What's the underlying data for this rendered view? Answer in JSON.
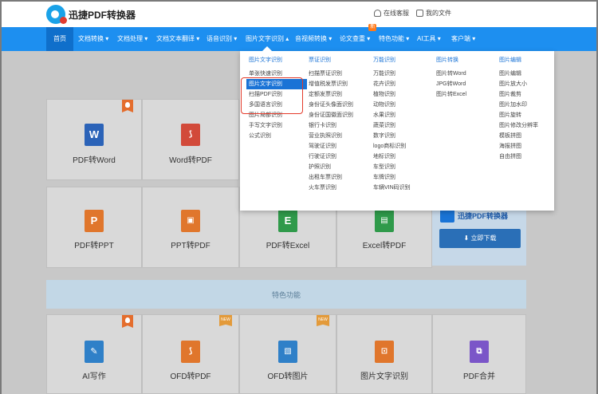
{
  "header": {
    "brand": "迅捷PDF转换器",
    "service_label": "在线客服",
    "files_label": "我的文件"
  },
  "nav": {
    "items": [
      {
        "label": "首页"
      },
      {
        "label": "文档转换 ▾"
      },
      {
        "label": "文档处理 ▾"
      },
      {
        "label": "文档文本翻译 ▾"
      },
      {
        "label": "语音识别 ▾"
      },
      {
        "label": "图片文字识别 ▴"
      },
      {
        "label": "音视频转换 ▾"
      },
      {
        "label": "论文查重 ▾"
      },
      {
        "label": "特色功能 ▾"
      },
      {
        "label": "AI工具 ▾"
      },
      {
        "label": "客户端 ▾"
      }
    ],
    "new_badge": "新"
  },
  "dropdown": {
    "columns": [
      {
        "title": "图片文字识别",
        "items": [
          "单张快速识别",
          "图片文字识别",
          "扫描PDF识别",
          "多国语言识别",
          "图片局部识别",
          "手写文字识别",
          "公式识别"
        ]
      },
      {
        "title": "票证识别",
        "items": [
          "扫描票证识别",
          "增值税发票识别",
          "定额发票识别",
          "身份证头像面识别",
          "身份证国徽面识别",
          "银行卡识别",
          "营业执照识别",
          "驾驶证识别",
          "行驶证识别",
          "护照识别",
          "出租车票识别",
          "火车票识别"
        ]
      },
      {
        "title": "万能识别",
        "items": [
          "万能识别",
          "花卉识别",
          "植物识别",
          "动物识别",
          "水果识别",
          "蔬菜识别",
          "数字识别",
          "logo商标识别",
          "地标识别",
          "车型识别",
          "车牌识别",
          "车辆VIN码识别"
        ]
      },
      {
        "title": "图片转换",
        "items": [
          "图片转Word",
          "JPG转Word",
          "图片转Excel"
        ]
      },
      {
        "title": "图片编辑",
        "items": [
          "图片编辑",
          "图片放大小",
          "图片裁剪",
          "图片加水印",
          "图片旋转",
          "图片修改分辨率",
          "模板拼图",
          "海报拼图",
          "自由拼图"
        ]
      }
    ]
  },
  "cards": {
    "row1": [
      {
        "label": "PDF转Word",
        "icon": "W"
      },
      {
        "label": "Word转PDF",
        "icon": "pdf-icon"
      }
    ],
    "row2": [
      {
        "label": "PDF转PPT",
        "icon": "P"
      },
      {
        "label": "PPT转PDF",
        "icon": "ppt-pdf-icon"
      },
      {
        "label": "PDF转Excel",
        "icon": "E"
      },
      {
        "label": "Excel转PDF",
        "icon": "excel-pdf-icon"
      }
    ],
    "row3": [
      {
        "label": "AI写作",
        "icon": "edit-icon"
      },
      {
        "label": "OFD转PDF",
        "icon": "ofd-pdf-icon"
      },
      {
        "label": "OFD转图片",
        "icon": "image-icon"
      },
      {
        "label": "图片文字识别",
        "icon": "ocr-icon"
      },
      {
        "label": "PDF合并",
        "icon": "merge-icon"
      }
    ],
    "new_tag": "NEW"
  },
  "promo": {
    "name": "迅捷PDF转换器",
    "download": "立即下载"
  },
  "section": {
    "title": "特色功能"
  },
  "colors": {
    "nav": "#1d8ff0",
    "accent": "#1a73d6",
    "highlight": "#e43a2a"
  }
}
